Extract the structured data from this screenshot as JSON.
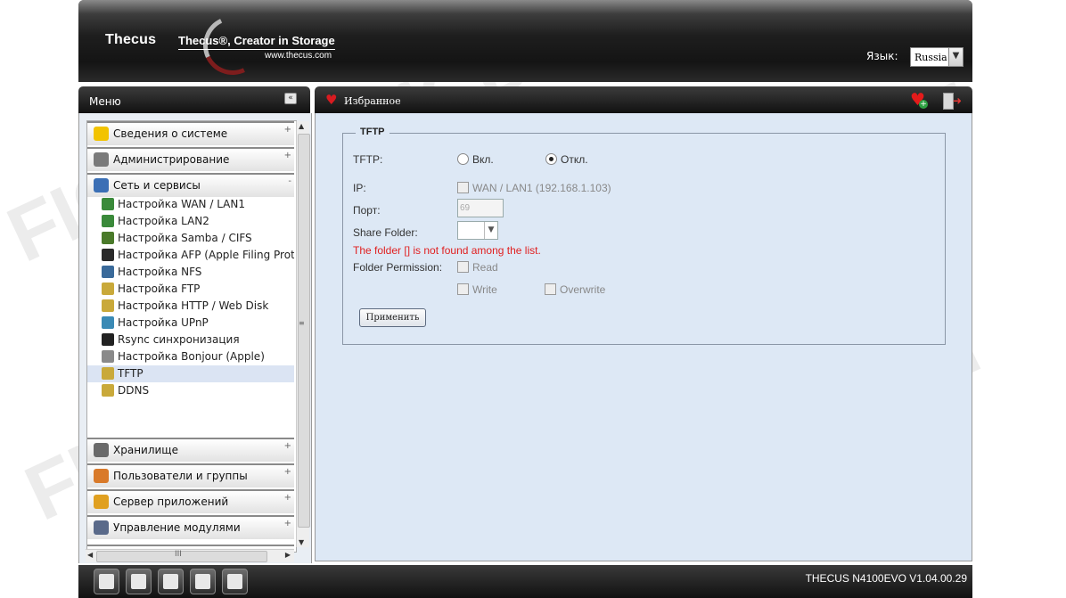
{
  "header": {
    "brand": "Thecus",
    "tagline": "Thecus®, Creator in Storage",
    "url": "www.thecus.com",
    "language_label": "Язык:",
    "language_value": "Russia"
  },
  "menu": {
    "title": "Меню",
    "collapse_glyph": "«",
    "categories_top": [
      {
        "label": "Сведения о системе",
        "toggle": "+",
        "icon": "info-icon",
        "color": "#f2c300"
      },
      {
        "label": "Администрирование",
        "toggle": "+",
        "icon": "tools-icon",
        "color": "#7a7a7a"
      },
      {
        "label": "Сеть и сервисы",
        "toggle": "-",
        "icon": "network-icon",
        "color": "#3b6fb5"
      }
    ],
    "sub_items": [
      {
        "label": "Настройка WAN / LAN1",
        "icon": "network-wan-icon",
        "color": "#3a8a3a"
      },
      {
        "label": "Настройка LAN2",
        "icon": "network-lan-icon",
        "color": "#3a8a3a"
      },
      {
        "label": "Настройка Samba / CIFS",
        "icon": "samba-icon",
        "color": "#4a7a2a"
      },
      {
        "label": "Настройка AFP (Apple Filing Protocol)",
        "icon": "afp-icon",
        "color": "#2a2a2a"
      },
      {
        "label": "Настройка NFS",
        "icon": "nfs-icon",
        "color": "#3a6a9a"
      },
      {
        "label": "Настройка FTP",
        "icon": "ftp-icon",
        "color": "#c9a93a"
      },
      {
        "label": "Настройка HTTP / Web Disk",
        "icon": "http-icon",
        "color": "#c9a93a"
      },
      {
        "label": "Настройка UPnP",
        "icon": "upnp-icon",
        "color": "#3a8ab5"
      },
      {
        "label": "Rsync синхронизация",
        "icon": "rsync-icon",
        "color": "#222222"
      },
      {
        "label": "Настройка Bonjour (Apple)",
        "icon": "bonjour-icon",
        "color": "#8a8a8a"
      },
      {
        "label": "TFTP",
        "icon": "tftp-icon",
        "color": "#c9a93a",
        "active": true
      },
      {
        "label": "DDNS",
        "icon": "ddns-icon",
        "color": "#c9a93a"
      }
    ],
    "categories_bottom": [
      {
        "label": "Хранилище",
        "toggle": "+",
        "icon": "storage-icon",
        "color": "#6a6a6a"
      },
      {
        "label": "Пользователи и группы",
        "toggle": "+",
        "icon": "users-icon",
        "color": "#d97a2a"
      },
      {
        "label": "Сервер приложений",
        "toggle": "+",
        "icon": "app-server-icon",
        "color": "#e0a020"
      },
      {
        "label": "Управление модулями",
        "toggle": "+",
        "icon": "modules-icon",
        "color": "#5a6a8a"
      }
    ],
    "hscroll_grip": "III",
    "vscroll_grip": "≡"
  },
  "main": {
    "title": "Избранное",
    "fieldset_title": "TFTP",
    "tftp_label": "TFTP:",
    "on_label": "Вкл.",
    "off_label": "Откл.",
    "tftp_enabled": false,
    "ip_label": "IP:",
    "ip_option": "WAN / LAN1 (192.168.1.103)",
    "port_label": "Порт:",
    "port_value": "69",
    "share_label": "Share Folder:",
    "error_text": "The folder [] is not found among the list.",
    "perm_label": "Folder Permission:",
    "read_label": "Read",
    "write_label": "Write",
    "overwrite_label": "Overwrite",
    "apply_label": "Применить"
  },
  "footer": {
    "buttons": [
      {
        "name": "raid-status-icon"
      },
      {
        "name": "disk-status-icon"
      },
      {
        "name": "fan-status-icon"
      },
      {
        "name": "temperature-icon"
      },
      {
        "name": "network-status-icon"
      }
    ],
    "version": "THECUS N4100EVO V1.04.00.29"
  },
  "watermark": "FICD.ru"
}
